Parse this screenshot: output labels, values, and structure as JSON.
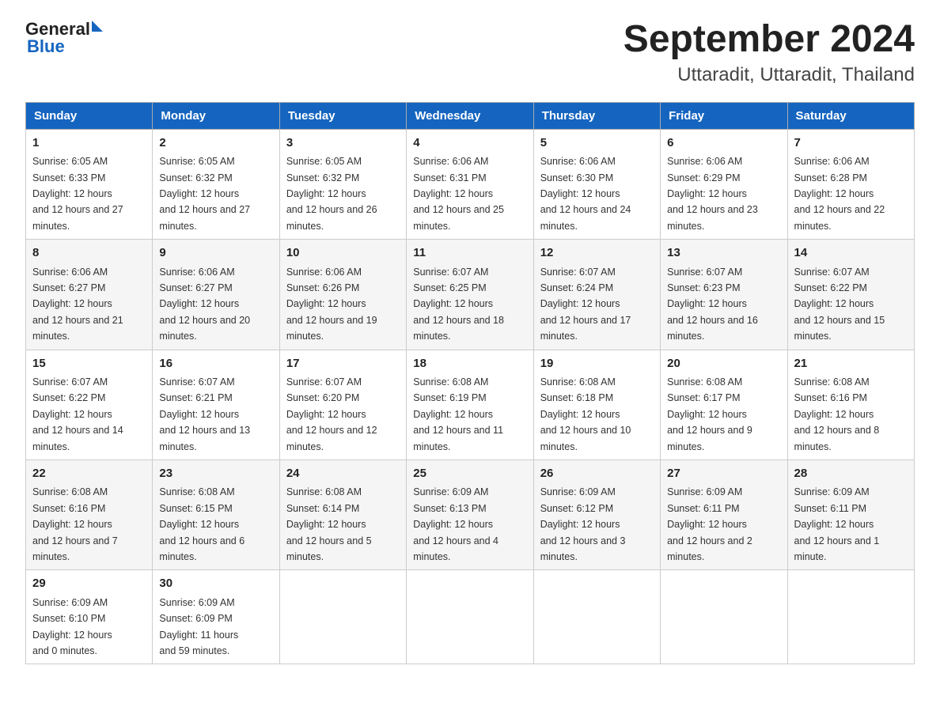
{
  "logo": {
    "text_general": "General",
    "triangle": "▶",
    "text_blue": "Blue"
  },
  "title": {
    "month_year": "September 2024",
    "location": "Uttaradit, Uttaradit, Thailand"
  },
  "days_of_week": [
    "Sunday",
    "Monday",
    "Tuesday",
    "Wednesday",
    "Thursday",
    "Friday",
    "Saturday"
  ],
  "weeks": [
    [
      {
        "day": "1",
        "sunrise": "6:05 AM",
        "sunset": "6:33 PM",
        "daylight": "12 hours and 27 minutes."
      },
      {
        "day": "2",
        "sunrise": "6:05 AM",
        "sunset": "6:32 PM",
        "daylight": "12 hours and 27 minutes."
      },
      {
        "day": "3",
        "sunrise": "6:05 AM",
        "sunset": "6:32 PM",
        "daylight": "12 hours and 26 minutes."
      },
      {
        "day": "4",
        "sunrise": "6:06 AM",
        "sunset": "6:31 PM",
        "daylight": "12 hours and 25 minutes."
      },
      {
        "day": "5",
        "sunrise": "6:06 AM",
        "sunset": "6:30 PM",
        "daylight": "12 hours and 24 minutes."
      },
      {
        "day": "6",
        "sunrise": "6:06 AM",
        "sunset": "6:29 PM",
        "daylight": "12 hours and 23 minutes."
      },
      {
        "day": "7",
        "sunrise": "6:06 AM",
        "sunset": "6:28 PM",
        "daylight": "12 hours and 22 minutes."
      }
    ],
    [
      {
        "day": "8",
        "sunrise": "6:06 AM",
        "sunset": "6:27 PM",
        "daylight": "12 hours and 21 minutes."
      },
      {
        "day": "9",
        "sunrise": "6:06 AM",
        "sunset": "6:27 PM",
        "daylight": "12 hours and 20 minutes."
      },
      {
        "day": "10",
        "sunrise": "6:06 AM",
        "sunset": "6:26 PM",
        "daylight": "12 hours and 19 minutes."
      },
      {
        "day": "11",
        "sunrise": "6:07 AM",
        "sunset": "6:25 PM",
        "daylight": "12 hours and 18 minutes."
      },
      {
        "day": "12",
        "sunrise": "6:07 AM",
        "sunset": "6:24 PM",
        "daylight": "12 hours and 17 minutes."
      },
      {
        "day": "13",
        "sunrise": "6:07 AM",
        "sunset": "6:23 PM",
        "daylight": "12 hours and 16 minutes."
      },
      {
        "day": "14",
        "sunrise": "6:07 AM",
        "sunset": "6:22 PM",
        "daylight": "12 hours and 15 minutes."
      }
    ],
    [
      {
        "day": "15",
        "sunrise": "6:07 AM",
        "sunset": "6:22 PM",
        "daylight": "12 hours and 14 minutes."
      },
      {
        "day": "16",
        "sunrise": "6:07 AM",
        "sunset": "6:21 PM",
        "daylight": "12 hours and 13 minutes."
      },
      {
        "day": "17",
        "sunrise": "6:07 AM",
        "sunset": "6:20 PM",
        "daylight": "12 hours and 12 minutes."
      },
      {
        "day": "18",
        "sunrise": "6:08 AM",
        "sunset": "6:19 PM",
        "daylight": "12 hours and 11 minutes."
      },
      {
        "day": "19",
        "sunrise": "6:08 AM",
        "sunset": "6:18 PM",
        "daylight": "12 hours and 10 minutes."
      },
      {
        "day": "20",
        "sunrise": "6:08 AM",
        "sunset": "6:17 PM",
        "daylight": "12 hours and 9 minutes."
      },
      {
        "day": "21",
        "sunrise": "6:08 AM",
        "sunset": "6:16 PM",
        "daylight": "12 hours and 8 minutes."
      }
    ],
    [
      {
        "day": "22",
        "sunrise": "6:08 AM",
        "sunset": "6:16 PM",
        "daylight": "12 hours and 7 minutes."
      },
      {
        "day": "23",
        "sunrise": "6:08 AM",
        "sunset": "6:15 PM",
        "daylight": "12 hours and 6 minutes."
      },
      {
        "day": "24",
        "sunrise": "6:08 AM",
        "sunset": "6:14 PM",
        "daylight": "12 hours and 5 minutes."
      },
      {
        "day": "25",
        "sunrise": "6:09 AM",
        "sunset": "6:13 PM",
        "daylight": "12 hours and 4 minutes."
      },
      {
        "day": "26",
        "sunrise": "6:09 AM",
        "sunset": "6:12 PM",
        "daylight": "12 hours and 3 minutes."
      },
      {
        "day": "27",
        "sunrise": "6:09 AM",
        "sunset": "6:11 PM",
        "daylight": "12 hours and 2 minutes."
      },
      {
        "day": "28",
        "sunrise": "6:09 AM",
        "sunset": "6:11 PM",
        "daylight": "12 hours and 1 minute."
      }
    ],
    [
      {
        "day": "29",
        "sunrise": "6:09 AM",
        "sunset": "6:10 PM",
        "daylight": "12 hours and 0 minutes."
      },
      {
        "day": "30",
        "sunrise": "6:09 AM",
        "sunset": "6:09 PM",
        "daylight": "11 hours and 59 minutes."
      },
      null,
      null,
      null,
      null,
      null
    ]
  ],
  "labels": {
    "sunrise": "Sunrise:",
    "sunset": "Sunset:",
    "daylight": "Daylight:"
  }
}
